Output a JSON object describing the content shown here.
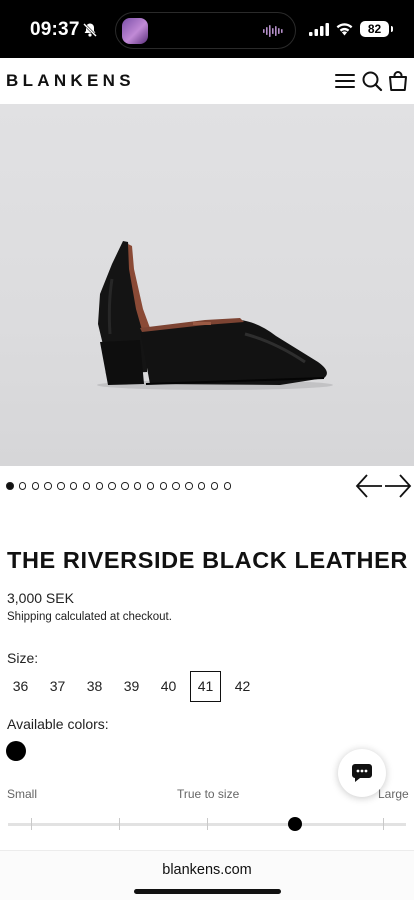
{
  "status_bar": {
    "time": "09:37",
    "battery": "82"
  },
  "header": {
    "brand": "BLANKENS",
    "icons": [
      "menu-icon",
      "search-icon",
      "bag-icon"
    ]
  },
  "gallery": {
    "image_count": 18,
    "active_index": 0
  },
  "product": {
    "title": "THE RIVERSIDE BLACK LEATHER",
    "price": "3,000 SEK",
    "shipping": "Shipping calculated at checkout."
  },
  "size": {
    "label": "Size:",
    "options": [
      "36",
      "37",
      "38",
      "39",
      "40",
      "41",
      "42"
    ],
    "selected": "41"
  },
  "colors": {
    "label": "Available colors:",
    "swatches": [
      "#000000"
    ]
  },
  "fit": {
    "small_label": "Small",
    "true_label": "True to size",
    "large_label": "Large",
    "value": 0.72
  },
  "browser": {
    "url": "blankens.com"
  }
}
